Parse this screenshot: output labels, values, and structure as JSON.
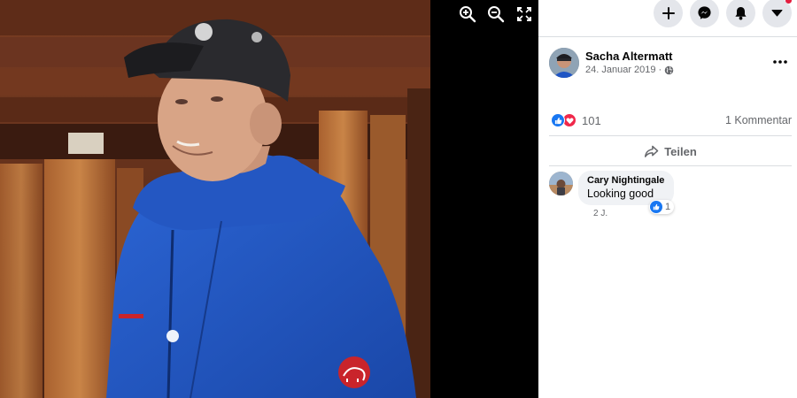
{
  "viewer": {
    "tools": {
      "zoom_in_icon": "zoom-in-icon",
      "zoom_out_icon": "zoom-out-icon",
      "fullscreen_icon": "fullscreen-icon"
    },
    "photo": {
      "subject": "man-in-cap-and-blue-jacket",
      "jacket_color": "#1f55c4",
      "badge": "mammoth-logo"
    }
  },
  "nav": {
    "buttons": [
      {
        "icon": "plus-icon"
      },
      {
        "icon": "messenger-icon"
      },
      {
        "icon": "bell-icon"
      },
      {
        "icon": "caret-down-icon",
        "has_notification_dot": true
      }
    ]
  },
  "post": {
    "author": "Sacha Altermatt",
    "date": "24. Januar 2019",
    "date_separator": "·",
    "audience_icon": "globe-icon",
    "more_icon": "more-icon",
    "reactions": {
      "types": [
        "like",
        "love"
      ],
      "count": "101"
    },
    "comment_count": "1 Kommentar",
    "share_label": "Teilen"
  },
  "comment": {
    "author": "Cary Nightingale",
    "text": "Looking good",
    "reaction_count": "1",
    "age": "2 J."
  },
  "colors": {
    "like_blue": "#1877f2",
    "love_red": "#f0284a",
    "secondary_text": "#65676b",
    "button_bg": "#e4e6eb",
    "bubble_bg": "#f0f2f5",
    "notification_red": "#e41e3f"
  }
}
